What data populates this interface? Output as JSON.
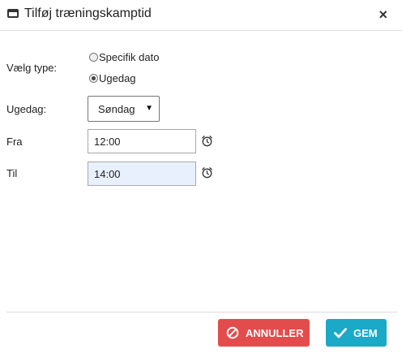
{
  "dialog": {
    "title": "Tilføj træningskamptid",
    "close_label": "×"
  },
  "form": {
    "type_label": "Vælg type:",
    "type_options": [
      {
        "label": "Specifik dato",
        "checked": false
      },
      {
        "label": "Ugedag",
        "checked": true
      }
    ],
    "weekday_label": "Ugedag:",
    "weekday_value": "Søndag",
    "from_label": "Fra",
    "from_value": "12:00",
    "to_label": "Til",
    "to_value": "14:00"
  },
  "footer": {
    "cancel_label": "ANNULLER",
    "save_label": "GEM"
  },
  "colors": {
    "cancel": "#e34c4c",
    "save": "#1aa9c6",
    "highlight_input": "#e8f0fe"
  },
  "icons": [
    "window-icon",
    "close-icon",
    "radio-icon",
    "dropdown-arrow-icon",
    "alarm-clock-icon",
    "ban-icon",
    "check-icon"
  ]
}
